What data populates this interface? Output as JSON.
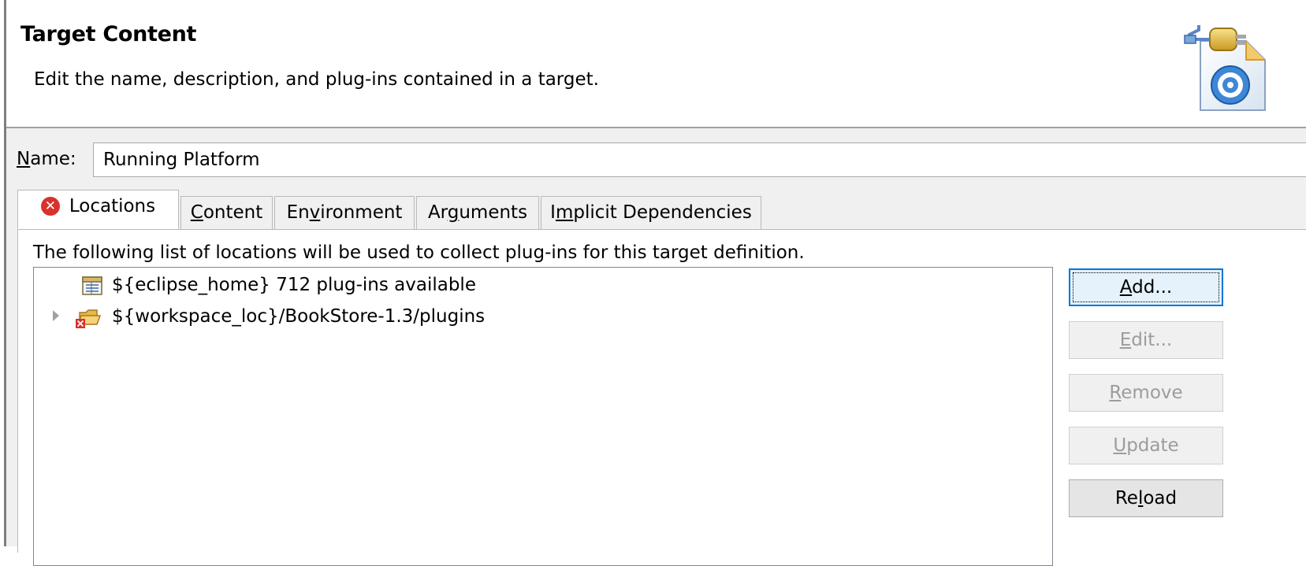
{
  "header": {
    "title": "Target Content",
    "description": "Edit the name, description, and plug-ins contained in a target.",
    "icon": "target-wizard-icon"
  },
  "name_field": {
    "label_mnemonic": "N",
    "label_rest": "ame:",
    "value": "Running Platform"
  },
  "tabs": [
    {
      "label": "Locations",
      "active": true,
      "icon": "error-icon"
    },
    {
      "pre": "",
      "mn": "C",
      "post": "ontent"
    },
    {
      "pre": "En",
      "mn": "v",
      "post": "ironment"
    },
    {
      "pre": "Ar",
      "mn": "g",
      "post": "uments"
    },
    {
      "pre": "I",
      "mn": "m",
      "post": "plicit Dependencies"
    }
  ],
  "locations_panel": {
    "description": "The following list of locations will be used to collect plug-ins for this target definition.",
    "items": [
      {
        "text": "${eclipse_home} 712 plug-ins available",
        "icon": "installation-icon",
        "expandable": false
      },
      {
        "text": "${workspace_loc}/BookStore-1.3/plugins",
        "icon": "folder-error-icon",
        "expandable": true
      }
    ]
  },
  "buttons": [
    {
      "mn": "A",
      "rest": "dd...",
      "state": "default"
    },
    {
      "mn": "E",
      "rest": "dit...",
      "state": "disabled"
    },
    {
      "mn": "R",
      "rest": "emove",
      "state": "disabled"
    },
    {
      "mn": "U",
      "rest": "pdate",
      "state": "disabled"
    },
    {
      "pre": "Re",
      "mn": "l",
      "rest": "oad",
      "state": "enabled"
    }
  ],
  "colors": {
    "panel_background": "#f0f0f0",
    "default_button_border": "#0078d7",
    "error_red": "#d9312c"
  }
}
